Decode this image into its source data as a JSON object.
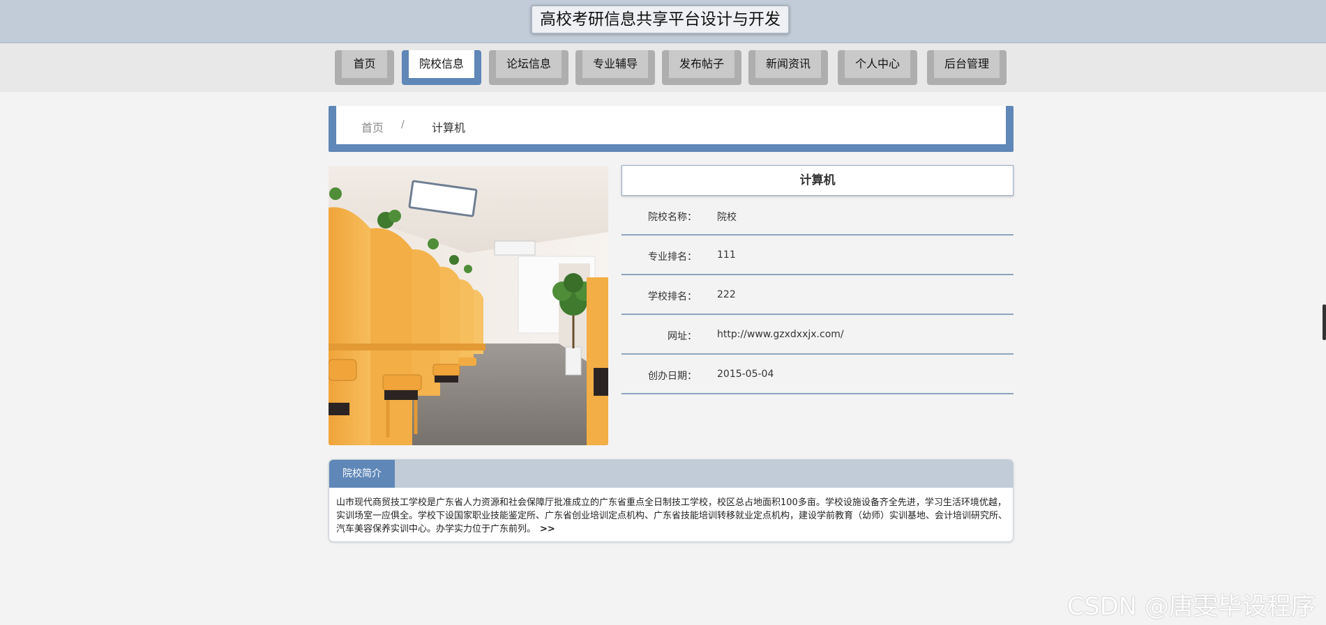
{
  "header": {
    "site_title": "高校考研信息共享平台设计与开发"
  },
  "nav": {
    "items": [
      {
        "label": "首页",
        "active": false
      },
      {
        "label": "院校信息",
        "active": true
      },
      {
        "label": "论坛信息",
        "active": false
      },
      {
        "label": "专业辅导",
        "active": false
      },
      {
        "label": "发布帖子",
        "active": false
      },
      {
        "label": "新闻资讯",
        "active": false
      },
      {
        "label": "个人中心",
        "active": false
      },
      {
        "label": "后台管理",
        "active": false
      }
    ]
  },
  "breadcrumb": {
    "home": "首页",
    "separator": "/",
    "current": "计算机"
  },
  "detail": {
    "title": "计算机",
    "fields": [
      {
        "label": "院校名称：",
        "value": "院校"
      },
      {
        "label": "专业排名：",
        "value": "111"
      },
      {
        "label": "学校排名：",
        "value": "222"
      },
      {
        "label": "网址：",
        "value": "http://www.gzxdxxjx.com/"
      },
      {
        "label": "创办日期：",
        "value": "2015-05-04"
      }
    ]
  },
  "intro": {
    "tab_label": "院校简介",
    "text": "山市现代商贸技工学校是广东省人力资源和社会保障厅批准成立的广东省重点全日制技工学校，校区总占地面积100多亩。学校设施设备齐全先进，学习生活环境优越，实训场室一应俱全。学校下设国家职业技能鉴定所、广东省创业培训定点机构、广东省技能培训转移就业定点机构，建设学前教育（幼师）实训基地、会计培训研究所、汽车美容保养实训中心。办学实力位于广东前列。",
    "more": ">>"
  },
  "watermark": "CSDN @唐雯毕设程序",
  "colors": {
    "accent": "#5f87b7",
    "header_bg": "#c1ccd8",
    "page_bg": "#f3f3f3"
  }
}
